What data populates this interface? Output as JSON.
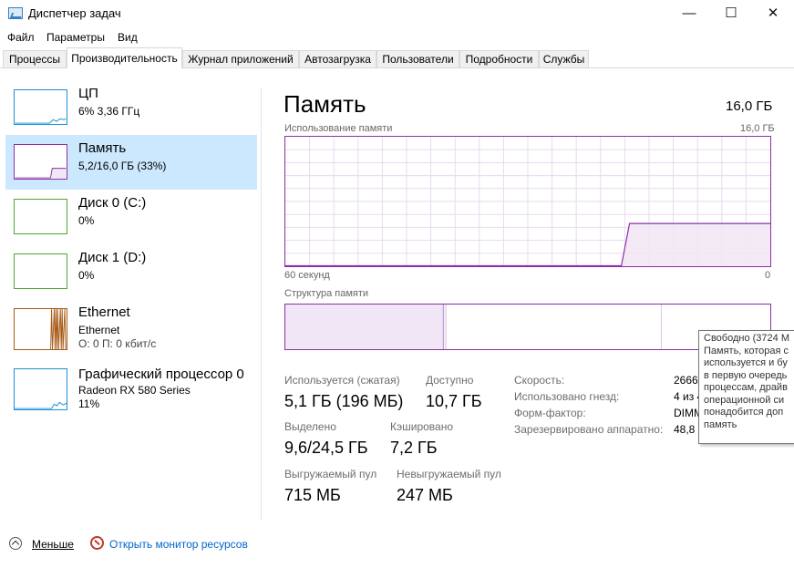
{
  "window": {
    "title": "Диспетчер задач",
    "minimize_glyph": "—",
    "maximize_glyph": "☐",
    "close_glyph": "✕"
  },
  "menu": [
    "Файл",
    "Параметры",
    "Вид"
  ],
  "tabs": [
    "Процессы",
    "Производительность",
    "Журнал приложений",
    "Автозагрузка",
    "Пользователи",
    "Подробности",
    "Службы"
  ],
  "active_tab": "Производительность",
  "sidebar": {
    "items": [
      {
        "title": "ЦП",
        "line1": "6% 3,36 ГГц",
        "line2": "",
        "color": "#1a8fd6",
        "kind": "cpu"
      },
      {
        "title": "Память",
        "line1": "5,2/16,0 ГБ (33%)",
        "line2": "",
        "color": "#8b2fa8",
        "kind": "memory"
      },
      {
        "title": "Диск 0 (C:)",
        "line1": "0%",
        "line2": "",
        "color": "#4ca72f",
        "kind": "disk"
      },
      {
        "title": "Диск 1 (D:)",
        "line1": "0%",
        "line2": "",
        "color": "#4ca72f",
        "kind": "disk"
      },
      {
        "title": "Ethernet",
        "line1": "Ethernet",
        "line2": "О: 0 П: 0 кбит/с",
        "color": "#a75a16",
        "kind": "ethernet"
      },
      {
        "title": "Графический процессор 0",
        "line1": "Radeon RX 580 Series",
        "line2": "11%",
        "color": "#1a8fd6",
        "kind": "gpu"
      }
    ],
    "selected": "Память"
  },
  "main": {
    "title": "Память",
    "total": "16,0 ГБ",
    "usage_label": "Использование памяти",
    "usage_max": "16,0 ГБ",
    "time_left": "60 секунд",
    "time_right": "0",
    "structure_label": "Структура памяти",
    "accent_color": "#8b2fa8",
    "usage_fraction": 0.33,
    "stats": {
      "in_use_label": "Используется (сжатая)",
      "in_use_value": "5,1 ГБ (196 МБ)",
      "available_label": "Доступно",
      "available_value": "10,7 ГБ",
      "committed_label": "Выделено",
      "committed_value": "9,6/24,5 ГБ",
      "cached_label": "Кэшировано",
      "cached_value": "7,2 ГБ",
      "paged_label": "Выгружаемый пул",
      "paged_value": "715 МБ",
      "nonpaged_label": "Невыгружаемый пул",
      "nonpaged_value": "247 МБ"
    },
    "details": {
      "speed_label": "Скорость:",
      "speed_value": "2666",
      "slots_label": "Использовано гнезд:",
      "slots_value": "4 из 4",
      "form_label": "Форм-фактор:",
      "form_value": "DIMM",
      "reserved_label": "Зарезервировано аппаратно:",
      "reserved_value": "48,8 М"
    }
  },
  "tooltip": {
    "lines": [
      "Свободно (3724 М",
      "Память, которая с",
      "используется и бу",
      "в первую очередь",
      "процессам, драйв",
      "операционной си",
      "понадобится доп",
      "память"
    ]
  },
  "footer": {
    "less_label": "Меньше",
    "monitor_link": "Открыть монитор ресурсов"
  }
}
